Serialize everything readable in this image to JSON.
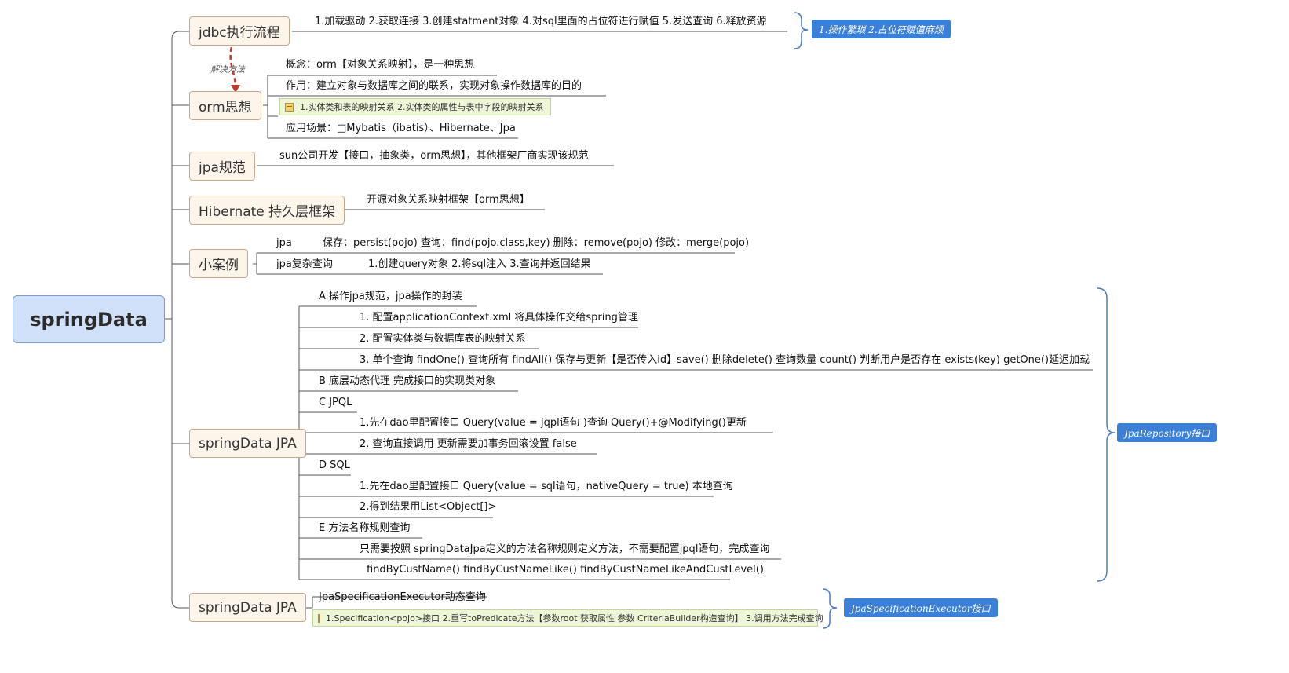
{
  "root": "springData",
  "branches": {
    "jdbc": {
      "title": "jdbc执行流程",
      "leaf": "1.加载驱动   2.获取连接   3.创建statment对象  4.对sql里面的占位符进行赋值  5.发送查询  6.释放资源",
      "summary": "1.操作繁琐 2.占位符赋值麻烦"
    },
    "relation_label": "解决方法",
    "orm": {
      "title": "orm思想",
      "concept": "概念：orm【对象关系映射】，是一种思想",
      "effect": "作用：建立对象与数据库之间的联系，实现对象操作数据库的目的",
      "note": "1.实体类和表的映射关系  2.实体类的属性与表中字段的映射关系",
      "scenario": "应用场景：□Mybatis（ibatis）、Hibernate、Jpa"
    },
    "jpa": {
      "title": "jpa规范",
      "leaf": "sun公司开发【接口，抽象类，orm思想】，其他框架厂商实现该规范"
    },
    "hibernate": {
      "title": "Hibernate 持久层框架",
      "leaf": "开源对象关系映射框架【orm思想】"
    },
    "case": {
      "title": "小案例",
      "row1_label": "jpa",
      "row1_text": "保存：persist(pojo)  查询：find(pojo.class,key)   删除：remove(pojo)   修改：merge(pojo)",
      "row2_label": "jpa复杂查询",
      "row2_text": "1.创建query对象   2.将sql注入    3.查询并返回结果"
    },
    "springdata_jpa": {
      "title": "springData JPA",
      "items": [
        "A    操作jpa规范，jpa操作的封装",
        "1.  配置applicationContext.xml   将具体操作交给spring管理",
        "2. 配置实体类与数据库表的映射关系",
        "3. 单个查询  findOne()  查询所有  findAll()   保存与更新【是否传入id】save()    删除delete()    查询数量  count()     判断用户是否存在  exists(key)    getOne()延迟加载",
        "B    底层动态代理   完成接口的实现类对象",
        "C  JPQL",
        "1.先在dao里配置接口         Query(value = jqpl语句 )查询              Query()+@Modifying()更新",
        "2.  查询直接调用    更新需要加事务回滚设置 false",
        "D SQL",
        "1.先在dao里配置接口 Query(value = sql语句，nativeQuery = true) 本地查询",
        "2.得到结果用List<Object[]>",
        "E 方法名称规则查询",
        "只需要按照 springDataJpa定义的方法名称规则定义方法，不需要配置jpql语句，完成查询",
        "findByCustName()  findByCustNameLike()  findByCustNameLikeAndCustLevel()"
      ],
      "summary": "JpaRepository接口"
    },
    "springdata_jpa2": {
      "title": "springData JPA",
      "leaf": "JpaSpecificationExecutor动态查询",
      "note": "1.Specification<pojo>接口  2.重写toPredicate方法【参数root 获取属性  参数 CriteriaBuilder构造查询】   3.调用方法完成查询",
      "summary": "JpaSpecificationExecutor接口"
    }
  },
  "colors": {
    "root_fill": "#cfe0f8",
    "topic_fill": "#fdf4ea",
    "summary_fill": "#3a7fd8",
    "note_fill": "#eef6d8",
    "relation_arrow": "#c0392b",
    "line": "#555555"
  },
  "icons": [
    "note-icon",
    "brace-icon",
    "arrow-icon"
  ]
}
